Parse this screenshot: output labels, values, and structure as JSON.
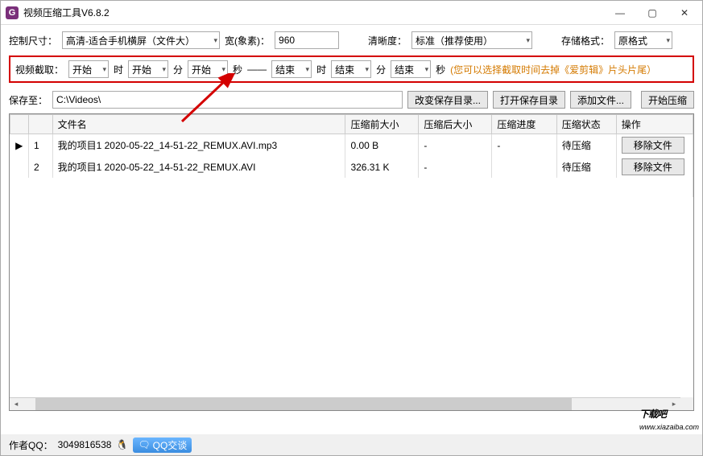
{
  "window": {
    "title": "视频压缩工具V6.8.2",
    "icon_letter": "G"
  },
  "controls": {
    "size_label": "控制尺寸：",
    "size_value": "高清-适合手机横屏（文件大）",
    "width_label": "宽(象素)：",
    "width_value": "960",
    "clarity_label": "清晰度：",
    "clarity_value": "标准（推荐使用）",
    "format_label": "存储格式：",
    "format_value": "原格式"
  },
  "clip": {
    "label": "视频截取：",
    "start": "开始",
    "end": "结束",
    "hour": "时",
    "minute": "分",
    "second": "秒",
    "divider": "——",
    "hint": "(您可以选择截取时间去掉《爱剪辑》片头片尾）"
  },
  "save": {
    "label": "保存至：",
    "path": "C:\\Videos\\",
    "change_dir": "改变保存目录...",
    "open_dir": "打开保存目录",
    "add_file": "添加文件...",
    "start_compress": "开始压缩"
  },
  "table": {
    "headers": {
      "indicator": "",
      "idx": "",
      "name": "文件名",
      "before": "压缩前大小",
      "after": "压缩后大小",
      "progress": "压缩进度",
      "status": "压缩状态",
      "action": "操作"
    },
    "rows": [
      {
        "indicator": "▶",
        "idx": "1",
        "name": "我的项目1 2020-05-22_14-51-22_REMUX.AVI.mp3",
        "before": "0.00 B",
        "after": "-",
        "progress": "-",
        "status": "待压缩",
        "action": "移除文件"
      },
      {
        "indicator": "",
        "idx": "2",
        "name": "我的项目1 2020-05-22_14-51-22_REMUX.AVI",
        "before": "326.31 K",
        "after": "-",
        "progress": "",
        "status": "待压缩",
        "action": "移除文件"
      }
    ]
  },
  "footer": {
    "author_label": "作者QQ：",
    "author_qq": "3049816538",
    "qq_badge": "QQ交谈"
  },
  "watermark": {
    "main": "下载吧",
    "sub": "www.xiazaiba.com"
  }
}
